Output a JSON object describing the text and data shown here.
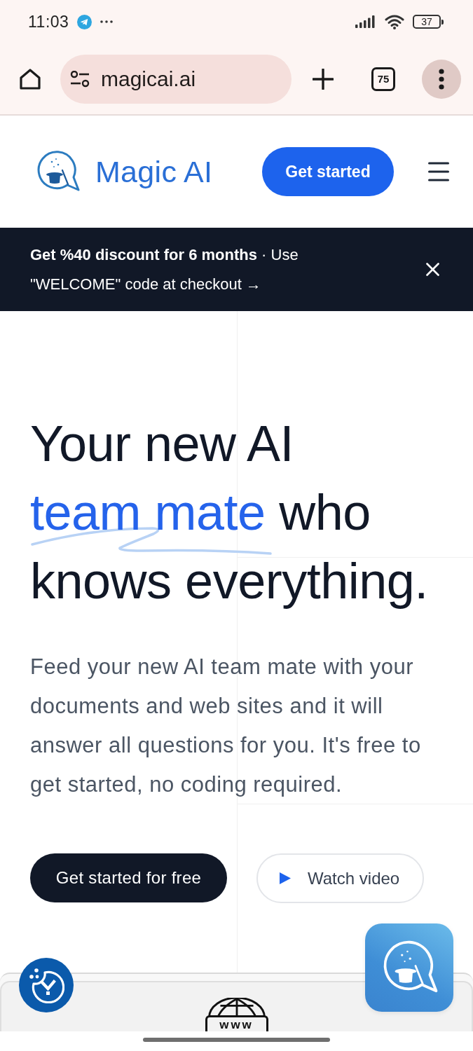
{
  "status_bar": {
    "time": "11:03",
    "battery": "37"
  },
  "browser_toolbar": {
    "url": "magicai.ai",
    "tab_count": "75"
  },
  "site_header": {
    "brand": "Magic AI",
    "cta": "Get started"
  },
  "promo_banner": {
    "text": "**Get %40 discount for 6 months** · Use \"WELCOME\" code at checkout →"
  },
  "hero": {
    "headline": {
      "line_1": "Your new AI",
      "highlight": "team mate",
      "line_2_rest": "who",
      "line_3": "knows everything."
    },
    "description": "Feed your new AI team mate with your documents and web sites and it will answer all questions for you. It's free to get started, no coding required.",
    "buttons": [
      {
        "kind": "primary",
        "label": "Get started for free"
      },
      {
        "kind": "video",
        "label": "Watch video"
      }
    ]
  },
  "bottom_card": {
    "icon_label": "www"
  }
}
